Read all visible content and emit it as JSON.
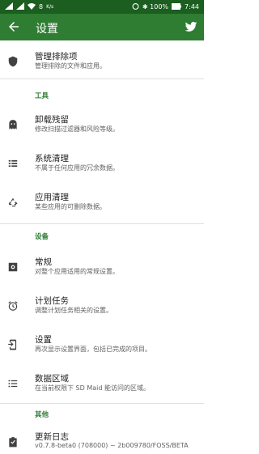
{
  "statusbar": {
    "left_texts": [
      "8",
      "K/s"
    ],
    "right_text": "✱ 100%",
    "time": "7:44"
  },
  "appbar": {
    "title": "设置",
    "back_icon": "arrow-back-icon",
    "action_icon": "twitter-icon"
  },
  "items": {
    "exclusions": {
      "title": "管理排除项",
      "sub": "管理排除的文件和应用。"
    },
    "tools_header": "工具",
    "corpse": {
      "title": "卸载残留",
      "sub": "修改扫描过滤器和风险等级。"
    },
    "system": {
      "title": "系统清理",
      "sub": "不属于任何应用的冗余数据。"
    },
    "app": {
      "title": "应用清理",
      "sub": "某些应用的可删除数据。"
    },
    "device_header": "设备",
    "general": {
      "title": "常规",
      "sub": "对整个应用适用的常规设置。"
    },
    "scheduler": {
      "title": "计划任务",
      "sub": "调整计划任务相关的设置。"
    },
    "setup": {
      "title": "设置",
      "sub": "再次显示设置界面，包括已完成的项目。"
    },
    "areas": {
      "title": "数据区域",
      "sub": "在当前权限下 SD Maid 能访问的区域。"
    },
    "other_header": "其他",
    "changelog": {
      "title": "更新日志",
      "sub": "v0.7.8-beta0 (708000) ~ 2b009780/FOSS/BETA"
    }
  },
  "colors": {
    "primary": "#2e7d32",
    "primary_dark": "#1b5e20",
    "icon": "#424242"
  }
}
